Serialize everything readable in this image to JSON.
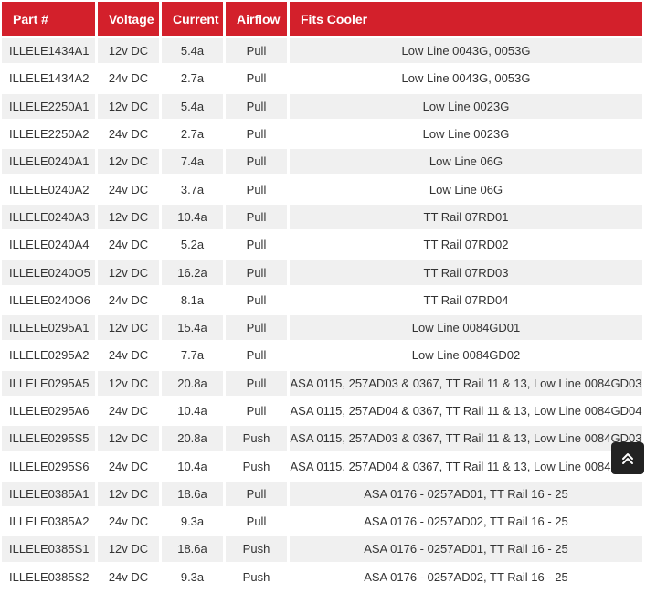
{
  "table": {
    "headers": [
      "Part #",
      "Voltage",
      "Current",
      "Airflow",
      "Fits Cooler"
    ],
    "rows": [
      [
        "ILLELE1434A1",
        "12v DC",
        "5.4a",
        "Pull",
        "Low Line 0043G, 0053G"
      ],
      [
        "ILLELE1434A2",
        "24v DC",
        "2.7a",
        "Pull",
        "Low Line 0043G, 0053G"
      ],
      [
        "ILLELE2250A1",
        "12v DC",
        "5.4a",
        "Pull",
        "Low Line 0023G"
      ],
      [
        "ILLELE2250A2",
        "24v DC",
        "2.7a",
        "Pull",
        "Low Line 0023G"
      ],
      [
        "ILLELE0240A1",
        "12v DC",
        "7.4a",
        "Pull",
        "Low Line 06G"
      ],
      [
        "ILLELE0240A2",
        "24v DC",
        "3.7a",
        "Pull",
        "Low Line 06G"
      ],
      [
        "ILLELE0240A3",
        "12v DC",
        "10.4a",
        "Pull",
        "TT Rail 07RD01"
      ],
      [
        "ILLELE0240A4",
        "24v DC",
        "5.2a",
        "Pull",
        "TT Rail 07RD02"
      ],
      [
        "ILLELE0240O5",
        "12v DC",
        "16.2a",
        "Pull",
        "TT Rail 07RD03"
      ],
      [
        "ILLELE0240O6",
        "24v DC",
        "8.1a",
        "Pull",
        "TT Rail 07RD04"
      ],
      [
        "ILLELE0295A1",
        "12v DC",
        "15.4a",
        "Pull",
        "Low Line 0084GD01"
      ],
      [
        "ILLELE0295A2",
        "24v DC",
        "7.7a",
        "Pull",
        "Low Line 0084GD02"
      ],
      [
        "ILLELE0295A5",
        "12v DC",
        "20.8a",
        "Pull",
        "ASA 0115, 257AD03 & 0367, TT Rail 11 & 13, Low Line 0084GD03"
      ],
      [
        "ILLELE0295A6",
        "24v DC",
        "10.4a",
        "Pull",
        "ASA 0115, 257AD04 & 0367, TT Rail 11 & 13, Low Line 0084GD04"
      ],
      [
        "ILLELE0295S5",
        "12v DC",
        "20.8a",
        "Push",
        "ASA 0115, 257AD03 & 0367, TT Rail 11 & 13, Low Line 0084GD03"
      ],
      [
        "ILLELE0295S6",
        "24v DC",
        "10.4a",
        "Push",
        "ASA 0115, 257AD04 & 0367, TT Rail 11 & 13, Low Line 0084GD04"
      ],
      [
        "ILLELE0385A1",
        "12v DC",
        "18.6a",
        "Pull",
        "ASA 0176 - 0257AD01, TT Rail 16 - 25"
      ],
      [
        "ILLELE0385A2",
        "24v DC",
        "9.3a",
        "Pull",
        "ASA 0176 - 0257AD02, TT Rail 16 - 25"
      ],
      [
        "ILLELE0385S1",
        "12v DC",
        "18.6a",
        "Push",
        "ASA 0176 - 0257AD01, TT Rail 16 - 25"
      ],
      [
        "ILLELE0385S2",
        "24v DC",
        "9.3a",
        "Push",
        "ASA 0176 - 0257AD02, TT Rail 16 - 25"
      ]
    ]
  },
  "scroll_top": {
    "icon": "double-chevron-up-icon"
  },
  "colors": {
    "header_bg": "#d3202b",
    "header_text": "#ffffff",
    "row_odd": "#f0f0f0",
    "row_even": "#ffffff",
    "text": "#333333",
    "scroll_bg": "#222222"
  }
}
